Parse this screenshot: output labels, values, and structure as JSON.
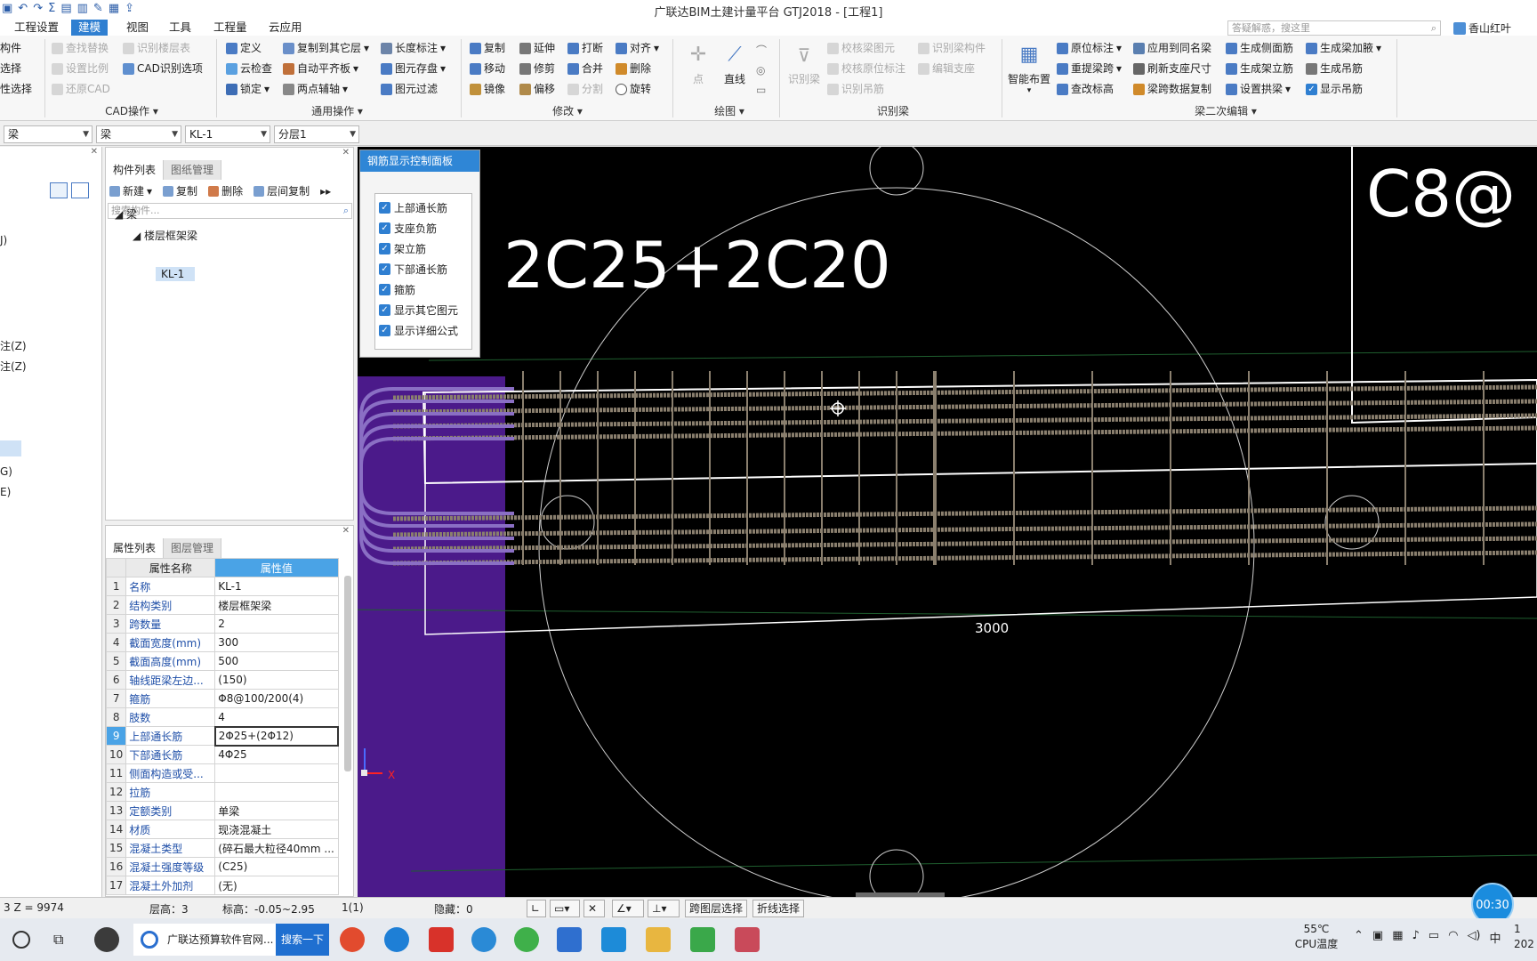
{
  "window": {
    "title": "广联达BIM土建计量平台 GTJ2018 - [工程1]"
  },
  "menubar": {
    "items": [
      "工程设置",
      "建模",
      "视图",
      "工具",
      "工程量",
      "云应用"
    ],
    "active_index": 1,
    "help_placeholder": "答疑解惑，搜这里",
    "user_name": "香山红叶"
  },
  "ribbon": {
    "left_partial": [
      "构件",
      "选择",
      "性选择"
    ],
    "cad": {
      "items": [
        "查找替换",
        "识别楼层表",
        "设置比例",
        "CAD识别选项",
        "还原CAD"
      ],
      "group": "CAD操作"
    },
    "general": {
      "items": [
        "定义",
        "复制到其它层",
        "长度标注",
        "云检查",
        "自动平齐板",
        "图元存盘",
        "锁定",
        "两点辅轴",
        "图元过滤"
      ],
      "group": "通用操作"
    },
    "modify": {
      "items": [
        "复制",
        "延伸",
        "打断",
        "对齐",
        "移动",
        "修剪",
        "合并",
        "删除",
        "镜像",
        "偏移",
        "分割",
        "旋转"
      ],
      "group": "修改"
    },
    "draw": {
      "items": [
        "点",
        "直线"
      ],
      "group": "绘图"
    },
    "recognize": {
      "items": [
        "识别梁",
        "校核梁图元",
        "识别梁构件",
        "校核原位标注",
        "编辑支座",
        "识别吊筋"
      ],
      "group": "识别梁"
    },
    "beam2": {
      "items": [
        "智能布置",
        "原位标注",
        "应用到同名梁",
        "生成侧面筋",
        "生成梁加腋",
        "重提梁跨",
        "刷新支座尺寸",
        "生成架立筋",
        "生成吊筋",
        "查改标高",
        "梁跨数据复制",
        "设置拱梁",
        "显示吊筋"
      ],
      "group": "梁二次编辑"
    }
  },
  "selectors": [
    "梁",
    "梁",
    "KL-1",
    "分层1"
  ],
  "leftnav": {
    "items": [
      "构件",
      "J)",
      "注(Z)",
      "注(Z)",
      "G)",
      "E)"
    ]
  },
  "component_panel": {
    "tabs": [
      "构件列表",
      "图纸管理"
    ],
    "toolbar": [
      "新建",
      "复制",
      "删除",
      "层间复制"
    ],
    "search_placeholder": "搜索构件...",
    "tree": [
      "梁",
      "楼层框架梁",
      "KL-1"
    ]
  },
  "property_panel": {
    "tabs": [
      "属性列表",
      "图层管理"
    ],
    "headers": [
      "属性名称",
      "属性值"
    ],
    "rows": [
      {
        "n": "1",
        "name": "名称",
        "value": "KL-1"
      },
      {
        "n": "2",
        "name": "结构类别",
        "value": "楼层框架梁"
      },
      {
        "n": "3",
        "name": "跨数量",
        "value": "2"
      },
      {
        "n": "4",
        "name": "截面宽度(mm)",
        "value": "300"
      },
      {
        "n": "5",
        "name": "截面高度(mm)",
        "value": "500"
      },
      {
        "n": "6",
        "name": "轴线距梁左边...",
        "value": "(150)"
      },
      {
        "n": "7",
        "name": "箍筋",
        "value": "Φ8@100/200(4)"
      },
      {
        "n": "8",
        "name": "肢数",
        "value": "4"
      },
      {
        "n": "9",
        "name": "上部通长筋",
        "value": "2Φ25+(2Φ12)"
      },
      {
        "n": "10",
        "name": "下部通长筋",
        "value": "4Φ25"
      },
      {
        "n": "11",
        "name": "侧面构造或受...",
        "value": ""
      },
      {
        "n": "12",
        "name": "拉筋",
        "value": ""
      },
      {
        "n": "13",
        "name": "定额类别",
        "value": "单梁"
      },
      {
        "n": "14",
        "name": "材质",
        "value": "现浇混凝土"
      },
      {
        "n": "15",
        "name": "混凝土类型",
        "value": "(碎石最大粒径40mm ..."
      },
      {
        "n": "16",
        "name": "混凝土强度等级",
        "value": "(C25)"
      },
      {
        "n": "17",
        "name": "混凝土外加剂",
        "value": "(无)"
      }
    ],
    "active_row": 8
  },
  "rebar_panel": {
    "title": "钢筋显示控制面板",
    "options": [
      "上部通长筋",
      "支座负筋",
      "架立筋",
      "下部通长筋",
      "箍筋",
      "显示其它图元",
      "显示详细公式"
    ]
  },
  "viewport": {
    "label_main": "2C25+2C20",
    "label_stirrup": "C8@",
    "dimension": "3000",
    "axis_x": "X"
  },
  "statusbar": {
    "coord": "3 Z = 9974",
    "floor_height": "层高：3",
    "elevation": "标高：-0.05~2.95",
    "count": "1(1)",
    "hidden": "隐藏：0",
    "btn_cross": "跨图层选择",
    "btn_fold": "折线选择"
  },
  "timer": "00:30",
  "taskbar": {
    "browser_label": "广联达预算软件官网...",
    "search_label": "搜索一下",
    "temperature": "55℃",
    "temp_label": "CPU温度",
    "clock_time": "1",
    "clock_date": "202"
  },
  "colors": {
    "accent": "#2f7fd1",
    "viewport_bg": "#000000",
    "column_purple": "#4b1a8a",
    "rebar": "#8a7f6e"
  }
}
